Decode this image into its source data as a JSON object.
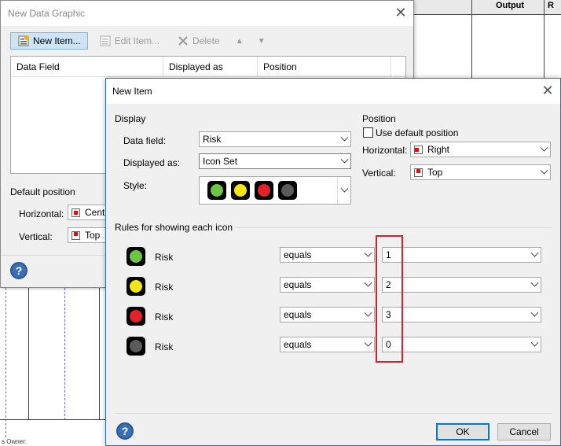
{
  "background": {
    "columns": [
      "Output",
      "R"
    ],
    "footer_text": "s Owner:"
  },
  "data_graphic_dialog": {
    "title": "New Data Graphic",
    "toolbar": {
      "new_item": "New Item...",
      "edit_item": "Edit Item...",
      "delete": "Delete"
    },
    "columns": [
      "Data Field",
      "Displayed as",
      "Position"
    ],
    "default_position_label": "Default position",
    "horizontal_label": "Horizontal:",
    "horizontal_value": "Cente",
    "vertical_label": "Vertical:",
    "vertical_value": "Top"
  },
  "new_item_dialog": {
    "title": "New Item",
    "display": {
      "group_title": "Display",
      "data_field_label": "Data field:",
      "data_field_value": "Risk",
      "displayed_as_label": "Displayed as:",
      "displayed_as_value": "Icon Set",
      "style_label": "Style:"
    },
    "position": {
      "group_title": "Position",
      "use_default_label": "Use default position",
      "horizontal_label": "Horizontal:",
      "horizontal_value": "Right",
      "vertical_label": "Vertical:",
      "vertical_value": "Top"
    },
    "rules_title": "Rules for showing each icon",
    "rules": [
      {
        "color": "#6cc644",
        "field": "Risk",
        "operator": "equals",
        "value": "1"
      },
      {
        "color": "#f5e613",
        "field": "Risk",
        "operator": "equals",
        "value": "2"
      },
      {
        "color": "#e4202a",
        "field": "Risk",
        "operator": "equals",
        "value": "3"
      },
      {
        "color": "#5a5a5a",
        "field": "Risk",
        "operator": "equals",
        "value": "0"
      }
    ],
    "ok_label": "OK",
    "cancel_label": "Cancel"
  },
  "icons": {
    "close": "close-icon",
    "help": "help-icon",
    "new_item": "new-item-icon",
    "edit_item": "edit-icon",
    "delete": "delete-icon",
    "move_up": "move-up-icon",
    "move_down": "move-down-icon"
  }
}
